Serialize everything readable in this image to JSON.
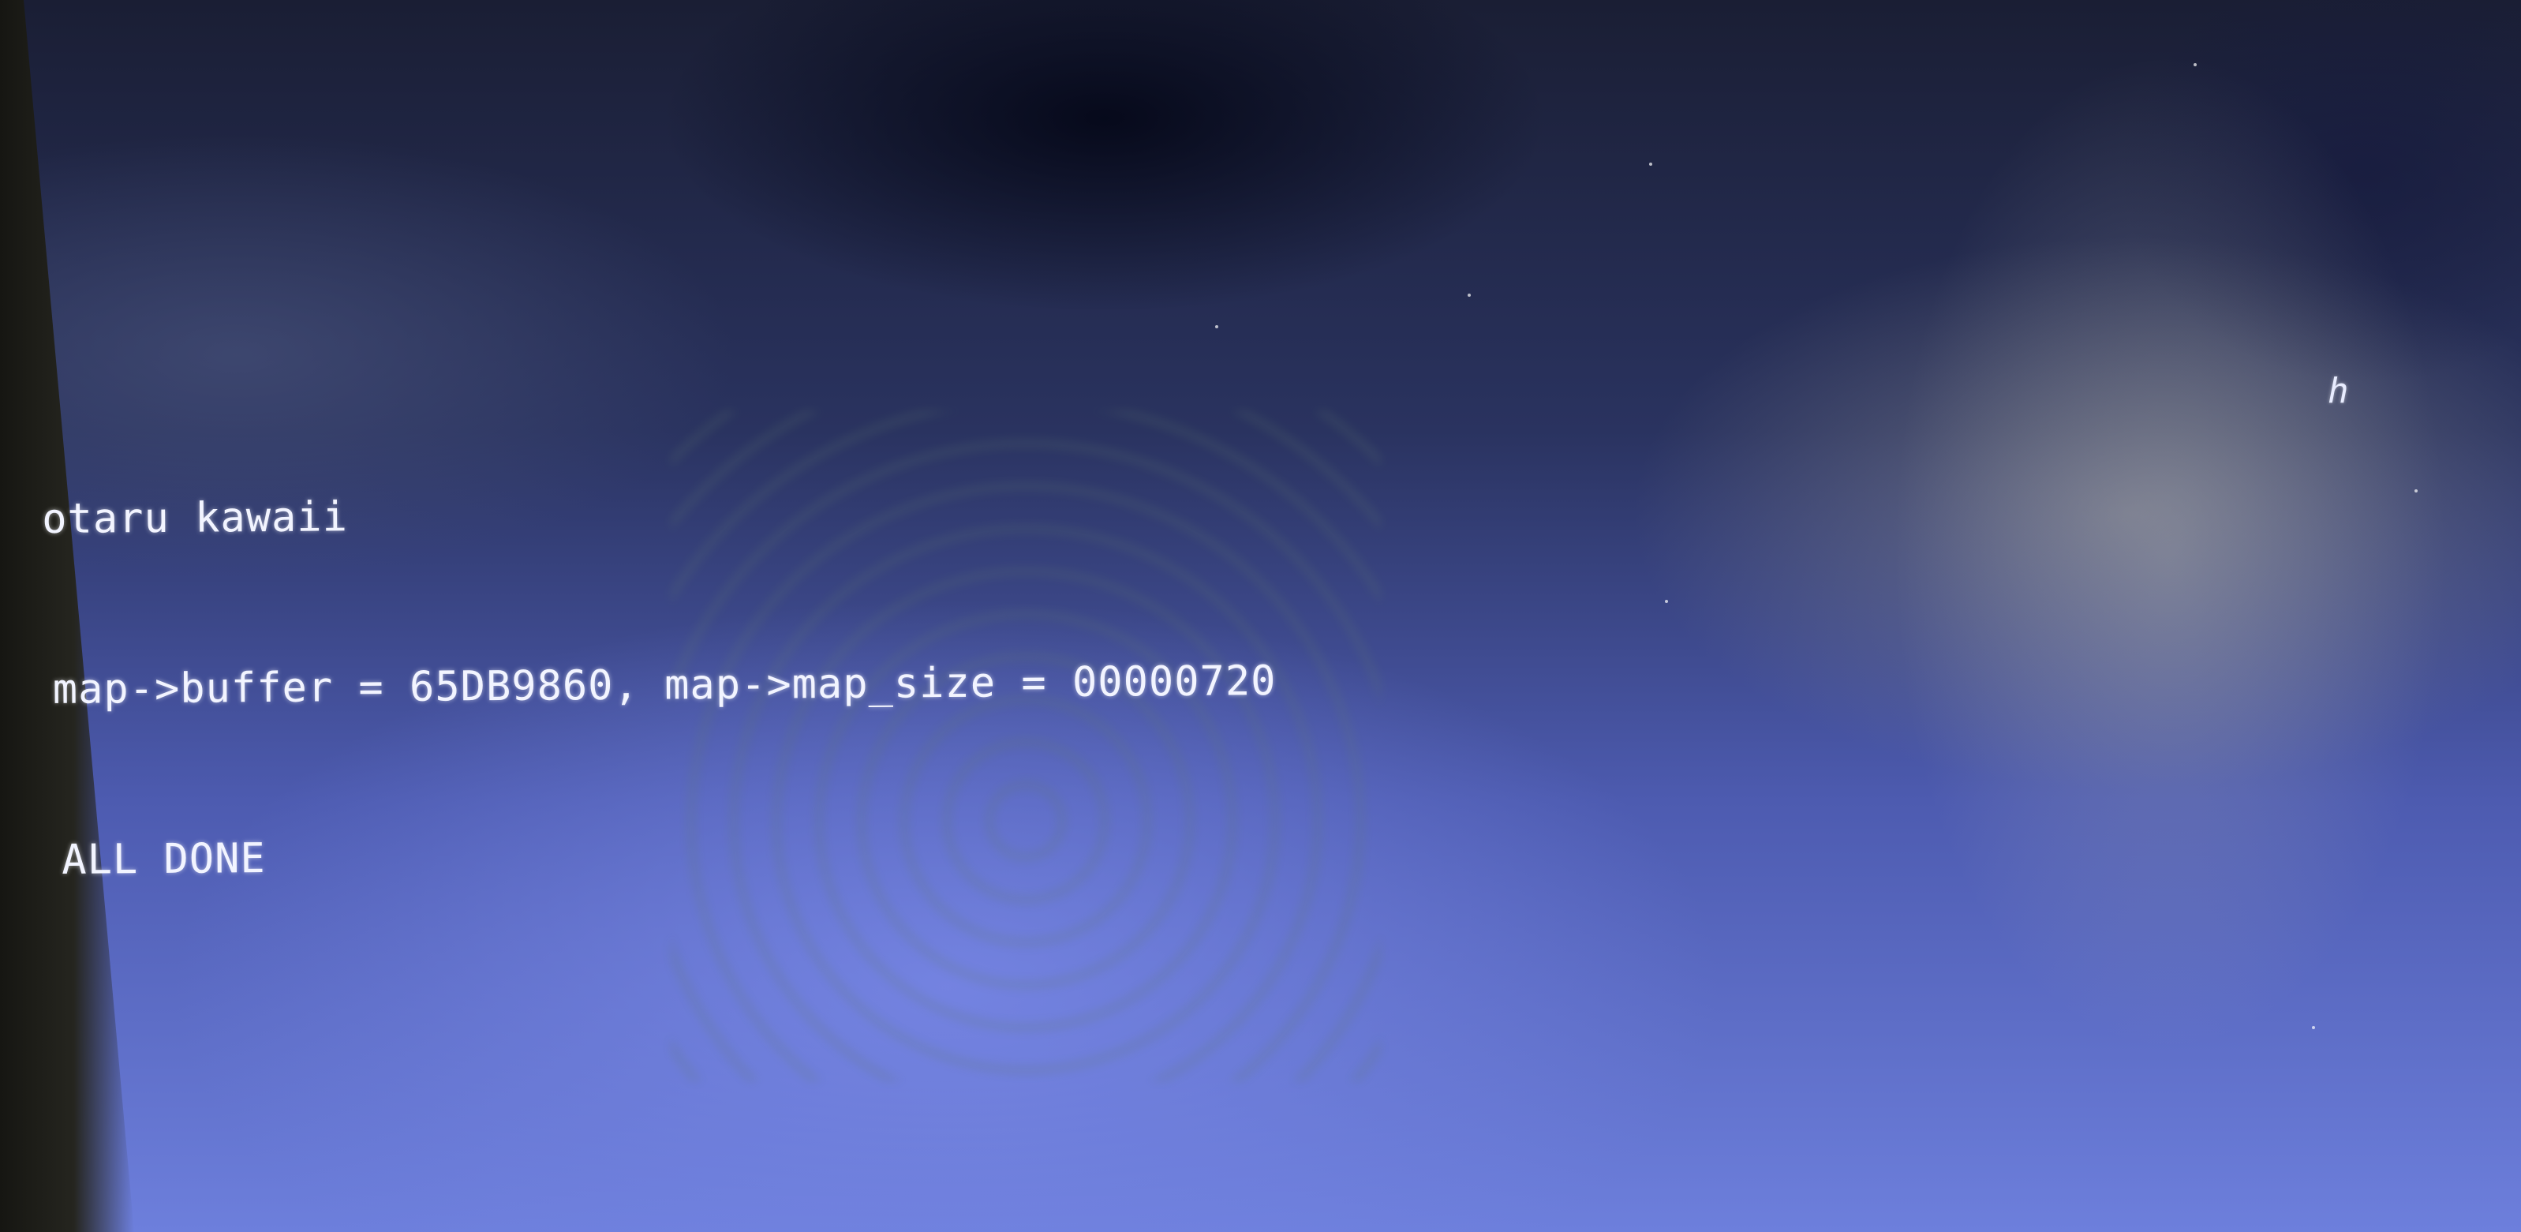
{
  "console": {
    "lines": [
      "otaru kawaii",
      "map->buffer = 65DB9860, map->map_size = 00000720",
      "ALL DONE"
    ],
    "stray_char": "h"
  },
  "colors": {
    "text": "#f2f4ff",
    "screen_background": "#4d5bb0"
  }
}
